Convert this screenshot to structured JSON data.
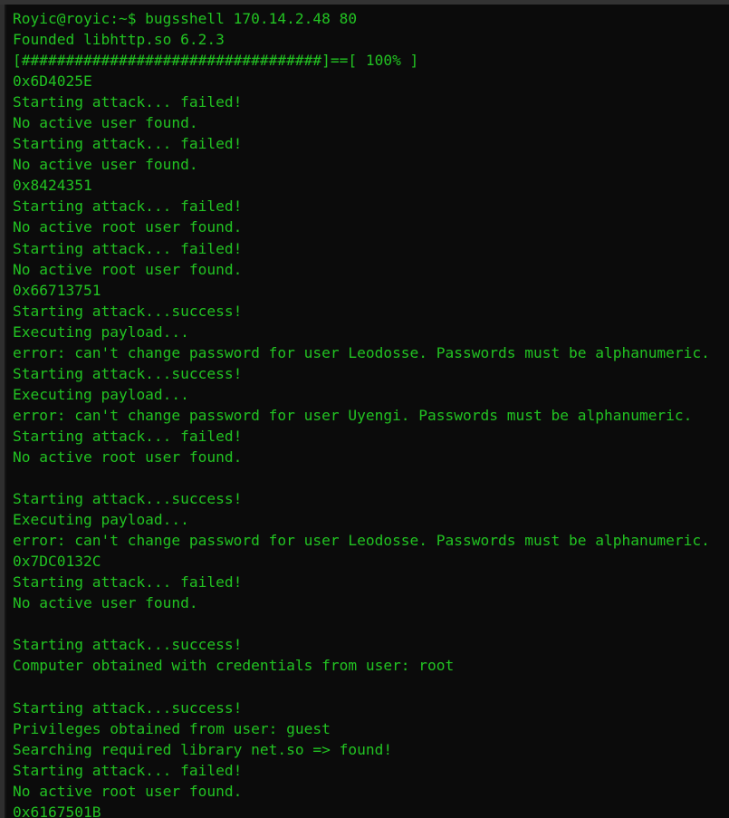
{
  "window": {
    "type": "terminal-emulator",
    "background_color": "#0b0b0b",
    "foreground_color": "#22c322",
    "chrome_color": "#333333"
  },
  "terminal": {
    "prompt_user": "Royic",
    "prompt_host": "royic",
    "prompt_path": "~",
    "prompt_symbol": "$",
    "command": "bugsshell 170.14.2.48 80",
    "progress": {
      "percent": "100%",
      "bar_fill_char": "#",
      "bar_fill_count": 34
    },
    "lines": [
      "Royic@royic:~$ bugsshell 170.14.2.48 80",
      "Founded libhttp.so 6.2.3",
      "[##################################]==[ 100% ]",
      "0x6D4025E",
      "Starting attack... failed!",
      "No active user found.",
      "Starting attack... failed!",
      "No active user found.",
      "0x8424351",
      "Starting attack... failed!",
      "No active root user found.",
      "Starting attack... failed!",
      "No active root user found.",
      "0x66713751",
      "Starting attack...success!",
      "Executing payload...",
      "error: can't change password for user Leodosse. Passwords must be alphanumeric.",
      "Starting attack...success!",
      "Executing payload...",
      "error: can't change password for user Uyengi. Passwords must be alphanumeric.",
      "Starting attack... failed!",
      "No active root user found.",
      "",
      "Starting attack...success!",
      "Executing payload...",
      "error: can't change password for user Leodosse. Passwords must be alphanumeric.",
      "0x7DC0132C",
      "Starting attack... failed!",
      "No active user found.",
      "",
      "Starting attack...success!",
      "Computer obtained with credentials from user: root",
      "",
      "Starting attack...success!",
      "Privileges obtained from user: guest",
      "Searching required library net.so => found!",
      "Starting attack... failed!",
      "No active root user found.",
      "0x6167501B"
    ]
  }
}
